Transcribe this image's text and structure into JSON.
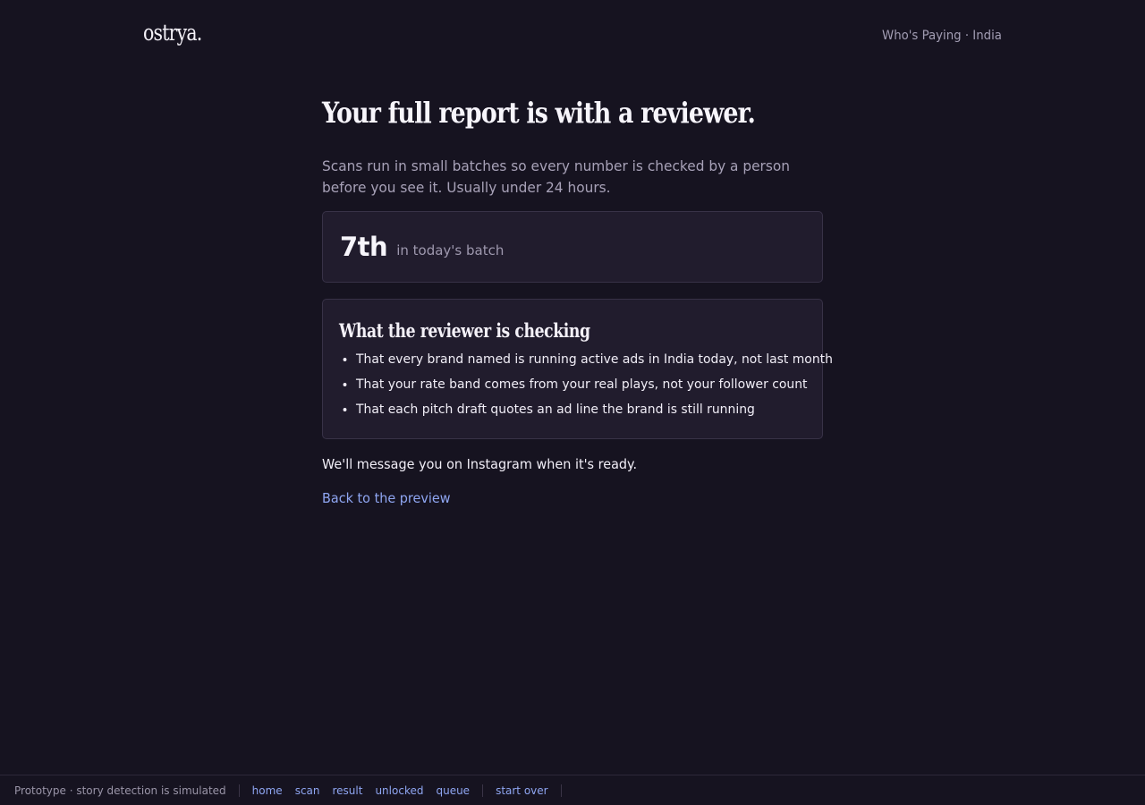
{
  "header": {
    "logo": "ostrya.",
    "product": "Who's Paying · India"
  },
  "main": {
    "title": "Your full report is with a reviewer.",
    "lead": "Scans run in small batches so every number is checked by a person before you see it. Usually under 24 hours.",
    "position": {
      "rank": "7th",
      "label": "in today's batch"
    },
    "checking": {
      "title": "What the reviewer is checking",
      "items": [
        "That every brand named is running active ads in India today, not last month",
        "That your rate band comes from your real plays, not your follower count",
        "That each pitch draft quotes an ad line the brand is still running"
      ]
    },
    "note": "We'll message you on Instagram when it's ready.",
    "back_link": "Back to the preview"
  },
  "footer": {
    "note": "Prototype · story detection is simulated",
    "links": [
      "home",
      "scan",
      "result",
      "unlocked",
      "queue"
    ],
    "start_over": "start over"
  },
  "colors": {
    "background": "#161320",
    "card": "#211c2d",
    "card_border": "#383247",
    "accent_link": "#8fa6f2",
    "muted_text": "#a7a1b7"
  }
}
